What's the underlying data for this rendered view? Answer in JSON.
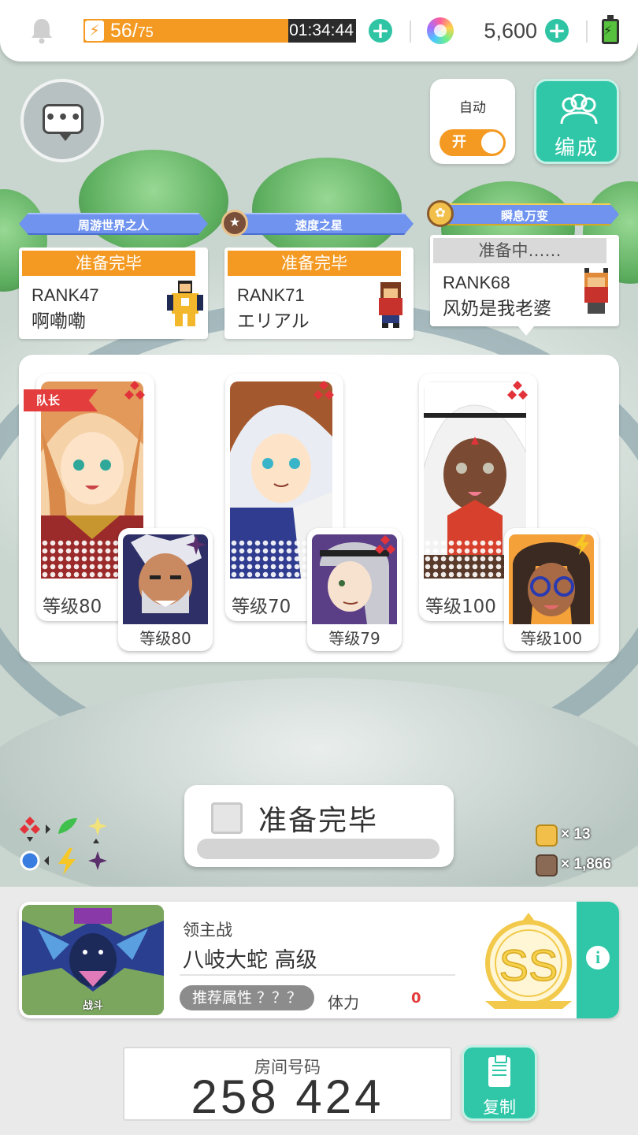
{
  "top_bar": {
    "stamina_current": "56",
    "stamina_max": "75",
    "stamina_fraction": 0.75,
    "stamina_timer": "01:34:44",
    "gem_count": "5,600",
    "colors": {
      "stamina": "#f49a22",
      "accent": "#2ec4a4"
    }
  },
  "controls": {
    "auto_label": "自动",
    "auto_toggle": "开",
    "edit_label": "编成"
  },
  "players": [
    {
      "title": "周游世界之人",
      "status": "准备完毕",
      "rank": "RANK47",
      "name": "啊嘞嘞"
    },
    {
      "title": "速度之星",
      "status": "准备完毕",
      "rank": "RANK71",
      "name": "エリアル"
    },
    {
      "title": "瞬息万变",
      "status": "准备中……",
      "rank": "RANK68",
      "name": "风奶是我老婆"
    }
  ],
  "team": {
    "leader_tag": "队长",
    "units": [
      {
        "main_level": "等级80",
        "sub_level": "等级80",
        "main_element": "fire",
        "sub_element": "dark"
      },
      {
        "main_level": "等级70",
        "sub_level": "等级79",
        "main_element": "fire",
        "sub_element": "fire"
      },
      {
        "main_level": "等级100",
        "sub_level": "等级100",
        "main_element": "fire",
        "sub_element": "thunder"
      }
    ]
  },
  "ready_button": {
    "label": "准备完毕"
  },
  "currencies": [
    {
      "name": "gold-medal",
      "amount": "× 13"
    },
    {
      "name": "bronze-medal",
      "amount": "× 1,866"
    }
  ],
  "boss": {
    "type": "领主战",
    "name": "八岐大蛇 高级",
    "image_caption": "战斗",
    "recommended_attr": "推荐属性 ？？？",
    "stamina_label": "体力",
    "stamina_value": "0",
    "rank": "SS"
  },
  "room": {
    "label": "房间号码",
    "number": "258 424",
    "copy_label": "复制"
  }
}
